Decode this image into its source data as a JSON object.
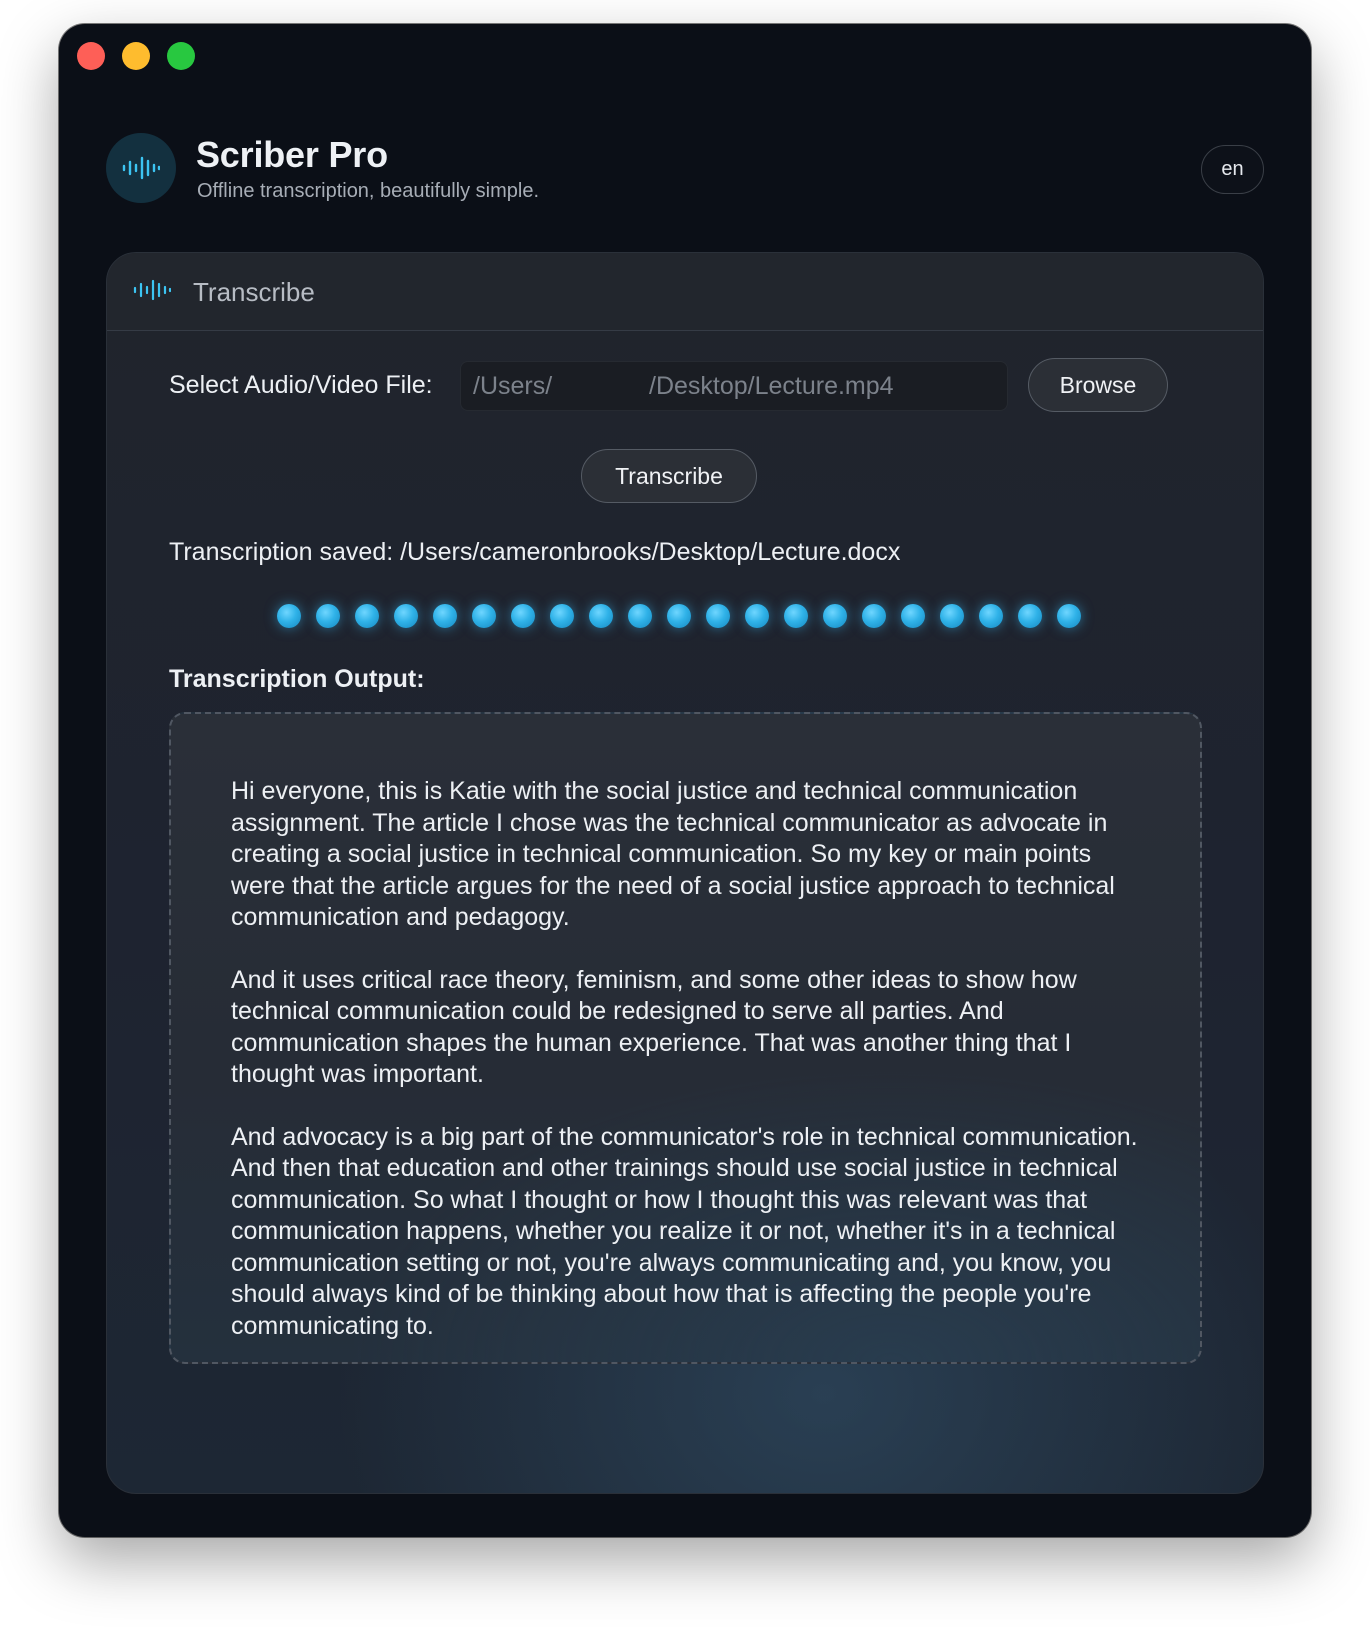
{
  "window": {
    "controls": [
      "close",
      "minimize",
      "zoom"
    ]
  },
  "app": {
    "logo_icon": "waveform-icon",
    "title": "Scriber Pro",
    "subtitle": "Offline transcription, beautifully simple.",
    "language": "en"
  },
  "card": {
    "header_icon": "waveform-icon",
    "header_title": "Transcribe",
    "file_label": "Select Audio/Video File:",
    "file_path_start": "/Users/",
    "file_path_end": "/Desktop/Lecture.mp4",
    "browse_label": "Browse",
    "transcribe_label": "Transcribe",
    "status": "Transcription saved: /Users/cameronbrooks/Desktop/Lecture.docx",
    "progress_dots": 21,
    "output_label": "Transcription Output:",
    "output_paragraphs": [
      "Hi everyone, this is Katie with the social justice and technical communication assignment. The article I chose was the technical communicator as advocate in creating a social justice in technical communication. So my key or main points were that the article argues for the need of a social justice approach to technical communication and pedagogy.",
      "And it uses critical race theory, feminism, and some other ideas to show how technical communication could be redesigned to serve all parties. And communication shapes the human experience. That was another thing that I thought was important.",
      "And advocacy is a big part of the communicator's role in technical communication. And then that education and other trainings should use social justice in technical communication. So what I thought or how I thought this was relevant was that communication happens, whether you realize it or not, whether it's in a technical communication setting or not, you're always communicating and, you know, you should always kind of be thinking about how that is affecting the people you're communicating to."
    ]
  },
  "colors": {
    "close": "#fe5f57",
    "minimize": "#febc2e",
    "zoom": "#28c840",
    "accent": "#2fb2e8"
  }
}
